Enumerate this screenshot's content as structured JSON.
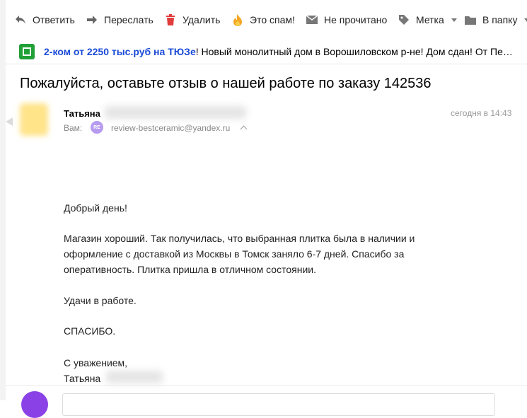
{
  "toolbar": {
    "reply": "Ответить",
    "forward": "Переслать",
    "delete": "Удалить",
    "spam": "Это спам!",
    "unread": "Не прочитано",
    "label": "Метка",
    "folder": "В папку"
  },
  "ad": {
    "bold": "2-ком от 2250 тыс.руб на ТЮЗе",
    "rest": "! Новый монолитный дом в Ворошиловском р-не! Дом сдан! От Пе…"
  },
  "message": {
    "subject": "Пожалуйста, оставьте отзыв о нашей работе по заказу 142536",
    "sender_name": "Татьяна",
    "to_label": "Вам:",
    "recipient_badge": "RE",
    "recipient_email": "review-bestceramic@yandex.ru",
    "time": "сегодня в 14:43",
    "body": {
      "greeting": "Добрый день!",
      "p1_l1": "Магазин хороший. Так получилась, что выбранная плитка была в наличии и",
      "p1_l2": "оформление с доставкой из Москвы в Томск заняло 6-7 дней. Спасибо за",
      "p1_l3": "оперативность. Плитка пришла в отличном состоянии.",
      "p2": "Удачи в работе.",
      "p3": "СПАСИБО.",
      "regards": "С уважением,",
      "signature": "Татьяна"
    }
  },
  "colors": {
    "ad_link": "#1b4bd6",
    "ad_logo": "#21a038",
    "delete_icon": "#e03c3c",
    "spam_icon": "#f5a623",
    "avatar_bottom": "#8a42e6",
    "recipient_badge": "#b79bf0"
  }
}
